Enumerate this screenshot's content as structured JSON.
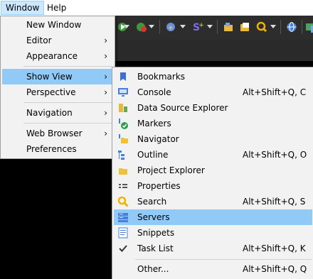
{
  "menubar": {
    "items": [
      {
        "label": "Window"
      },
      {
        "label": "Help"
      }
    ]
  },
  "window_menu": {
    "items": [
      {
        "label": "New Window"
      },
      {
        "label": "Editor"
      },
      {
        "label": "Appearance"
      },
      {
        "label": "Show View"
      },
      {
        "label": "Perspective"
      },
      {
        "label": "Navigation"
      },
      {
        "label": "Web Browser"
      },
      {
        "label": "Preferences"
      }
    ],
    "submenu_arrow": "›"
  },
  "show_view_menu": {
    "items": [
      {
        "label": "Bookmarks",
        "shortcut": "",
        "icon": "bookmark-icon"
      },
      {
        "label": "Console",
        "shortcut": "Alt+Shift+Q, C",
        "icon": "console-icon"
      },
      {
        "label": "Data Source Explorer",
        "shortcut": "",
        "icon": "data-source-icon"
      },
      {
        "label": "Markers",
        "shortcut": "",
        "icon": "markers-icon"
      },
      {
        "label": "Navigator",
        "shortcut": "",
        "icon": "folder-icon"
      },
      {
        "label": "Outline",
        "shortcut": "Alt+Shift+Q, O",
        "icon": "outline-icon"
      },
      {
        "label": "Project Explorer",
        "shortcut": "",
        "icon": "folder-icon"
      },
      {
        "label": "Properties",
        "shortcut": "",
        "icon": "properties-icon"
      },
      {
        "label": "Search",
        "shortcut": "Alt+Shift+Q, S",
        "icon": "search-icon"
      },
      {
        "label": "Servers",
        "shortcut": "",
        "icon": "servers-icon"
      },
      {
        "label": "Snippets",
        "shortcut": "",
        "icon": "snippets-icon"
      },
      {
        "label": "Task List",
        "shortcut": "Alt+Shift+Q, K",
        "icon": "check-icon"
      },
      {
        "label": "Other...",
        "shortcut": "Alt+Shift+Q, Q",
        "icon": ""
      }
    ]
  },
  "colors": {
    "highlight": "#91c9f7",
    "menu_bg": "#f2f2f2",
    "menubar_active": "#cce8ff"
  }
}
